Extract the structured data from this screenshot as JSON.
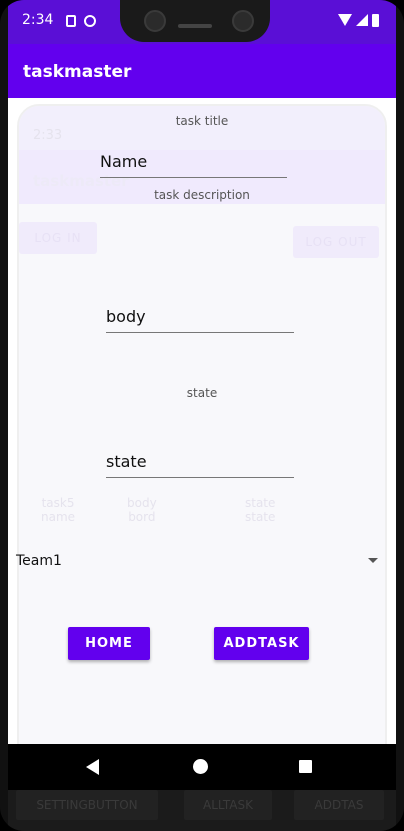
{
  "status_bar": {
    "time": "2:34"
  },
  "app_bar": {
    "title": "taskmaster"
  },
  "ghost": {
    "time": "2:33",
    "title": "taskmaster",
    "login": "LOG IN",
    "logout": "LOG OUT",
    "col1": "task5\nname",
    "col2": "body\nbord",
    "col3": "state\nstate"
  },
  "form": {
    "title_label": "task title",
    "title_value": "Name",
    "description_label": "task description",
    "body_value": "body",
    "state_label": "state",
    "state_value": "state",
    "team_selected": "Team1"
  },
  "buttons": {
    "home": "HOME",
    "addtask": "ADDTASK"
  },
  "ghost_bottom": {
    "setting": "SETTINGBUTTON",
    "alltask": "ALLTASK",
    "addtask": "ADDTAS"
  }
}
